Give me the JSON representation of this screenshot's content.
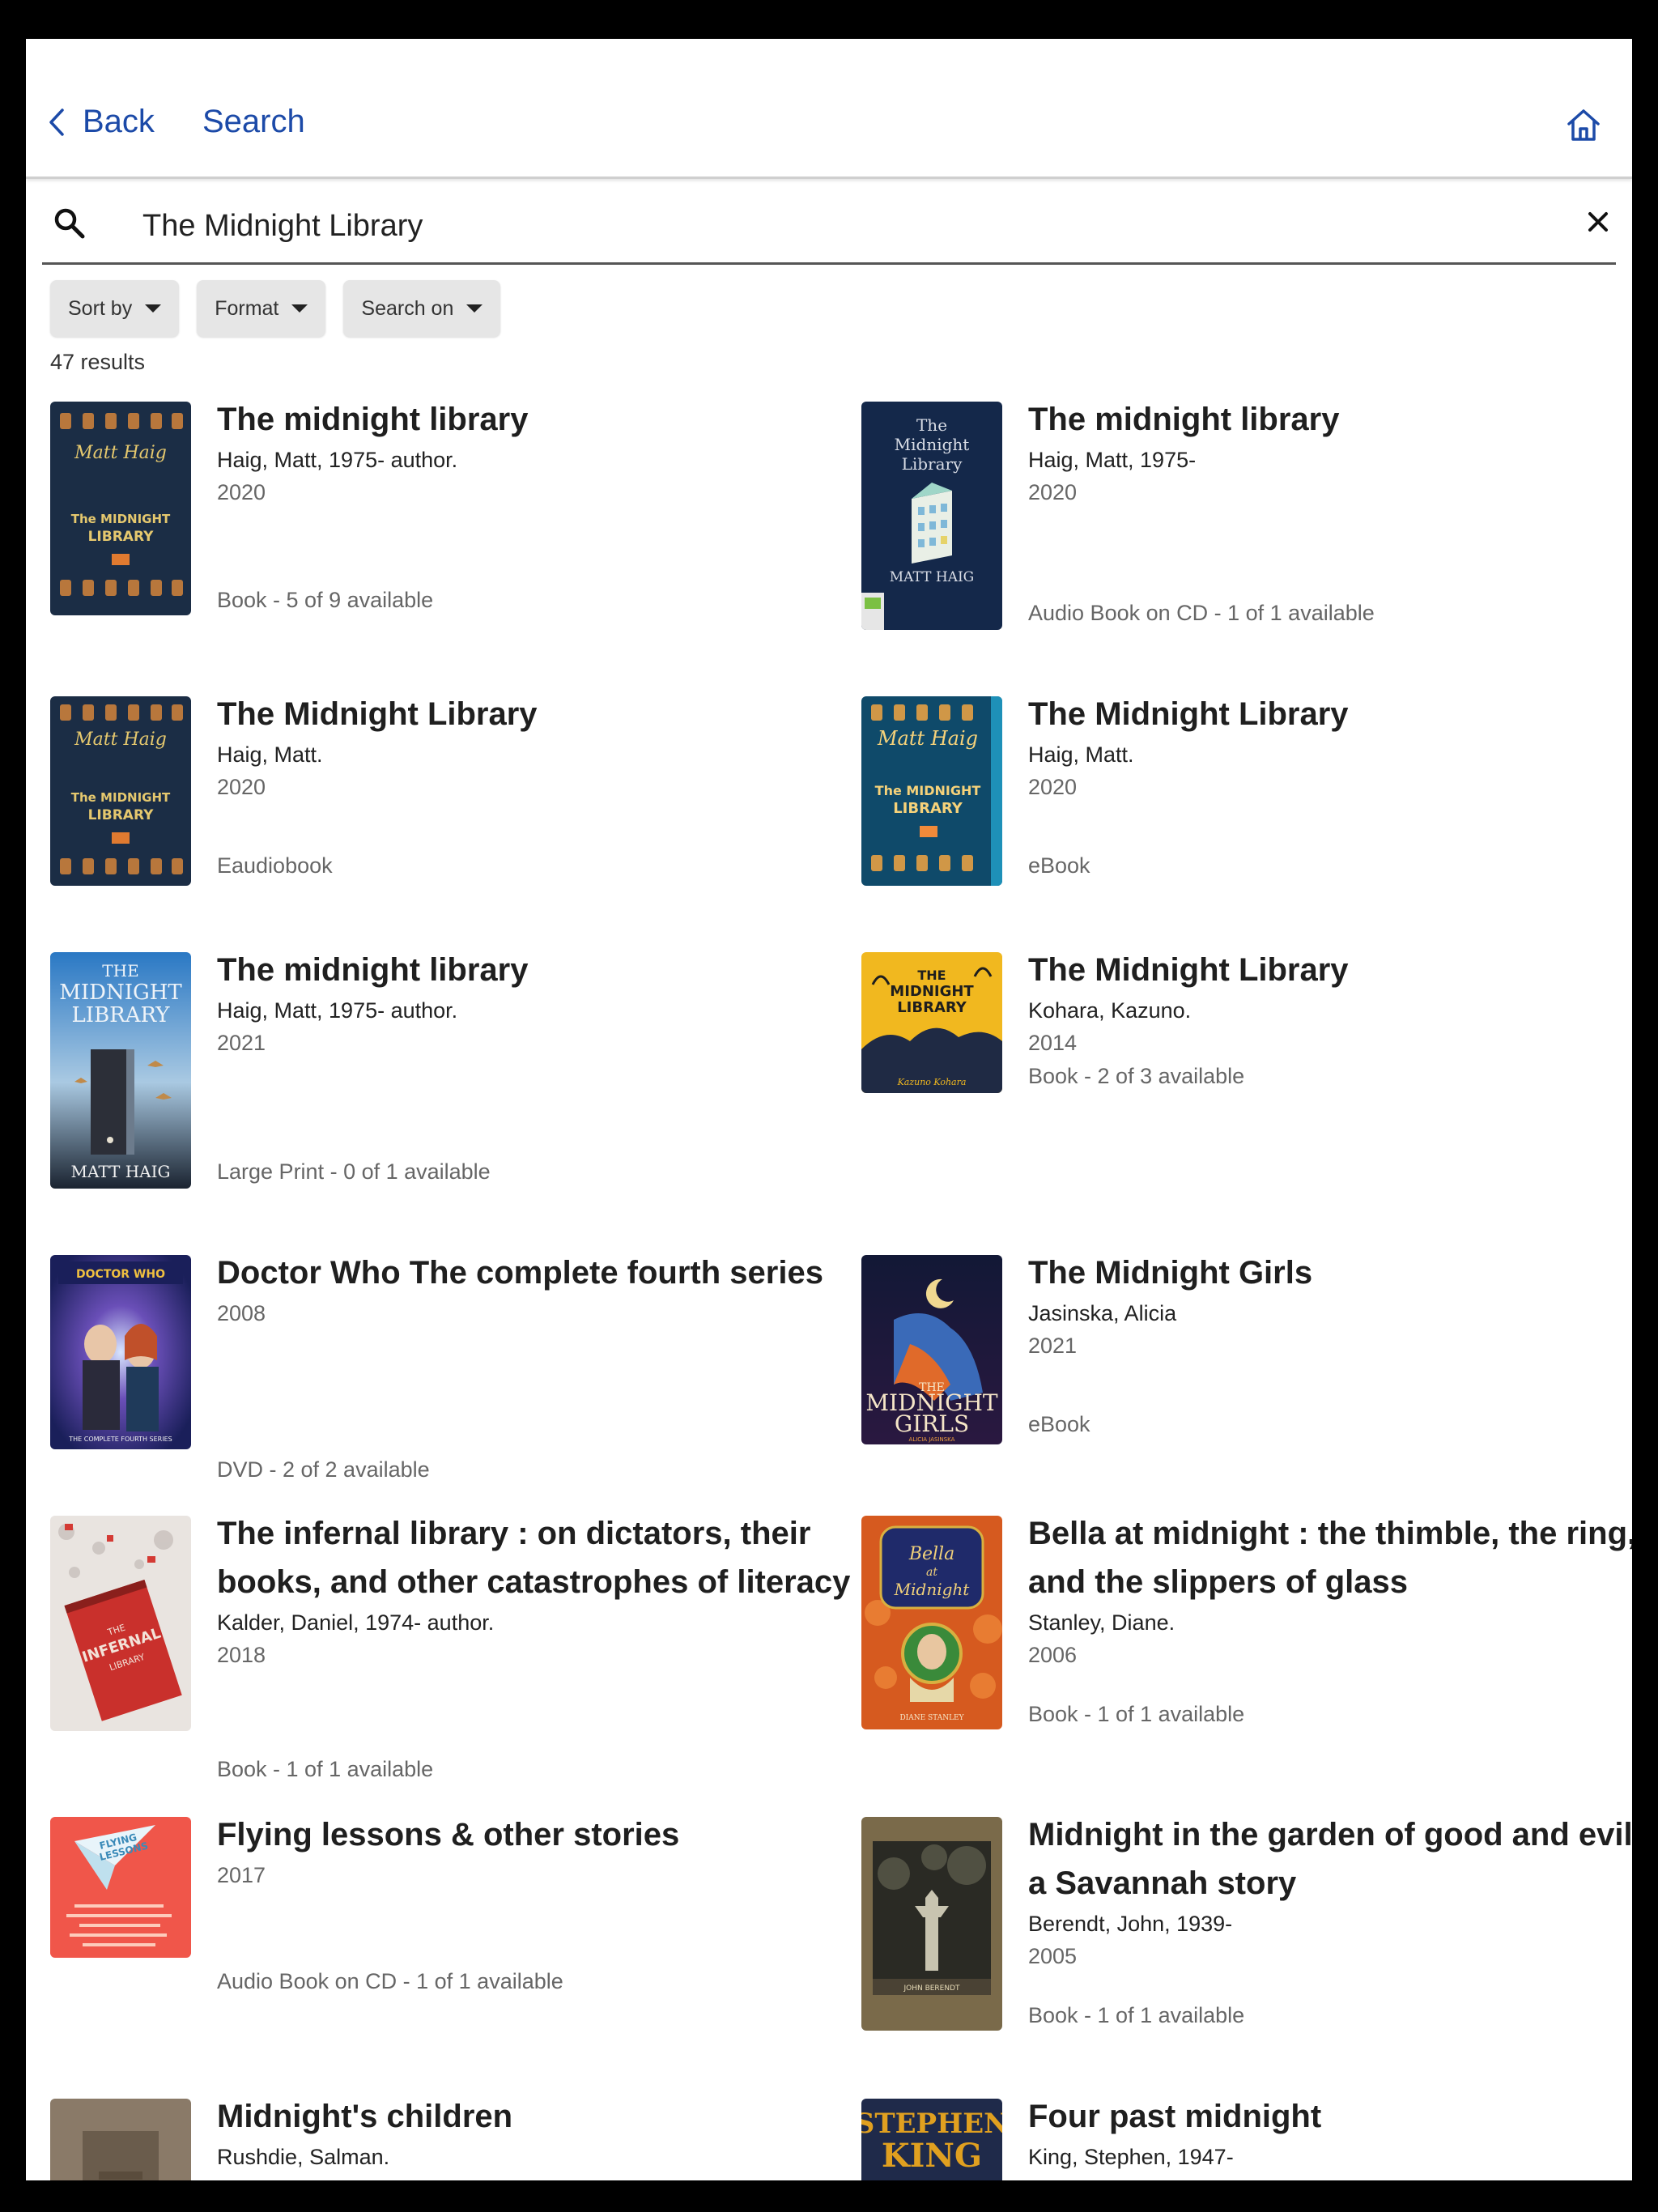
{
  "header": {
    "back_label": "Back",
    "search_label": "Search"
  },
  "search": {
    "query": "The Midnight Library",
    "placeholder": ""
  },
  "filters": {
    "sort_by": "Sort by",
    "format": "Format",
    "search_on": "Search on"
  },
  "results_count": "47 results",
  "results": [
    {
      "title": "The midnight library",
      "author": "Haig, Matt, 1975- author.",
      "year": "2020",
      "availability": "Book - 5 of 9 available"
    },
    {
      "title": "The midnight library",
      "author": "Haig, Matt, 1975-",
      "year": "2020",
      "availability": "Audio Book on CD - 1 of 1 available"
    },
    {
      "title": "The Midnight Library",
      "author": "Haig, Matt.",
      "year": "2020",
      "availability": "Eaudiobook"
    },
    {
      "title": "The Midnight Library",
      "author": "Haig, Matt.",
      "year": "2020",
      "availability": "eBook"
    },
    {
      "title": "The midnight library",
      "author": "Haig, Matt, 1975- author.",
      "year": "2021",
      "availability": "Large Print - 0 of 1 available"
    },
    {
      "title": "The Midnight Library",
      "author": "Kohara, Kazuno.",
      "year": "2014",
      "availability": "Book - 2 of 3 available"
    },
    {
      "title": "Doctor Who The complete fourth series",
      "author": "",
      "year": "2008",
      "availability": "DVD - 2 of 2 available"
    },
    {
      "title": "The Midnight Girls",
      "author": "Jasinska, Alicia",
      "year": "2021",
      "availability": "eBook"
    },
    {
      "title": "The infernal library : on dictators, their books, and other catastrophes of literacy",
      "author": "Kalder, Daniel, 1974- author.",
      "year": "2018",
      "availability": "Book - 1 of 1 available"
    },
    {
      "title": "Bella at midnight : the thimble, the ring, and the slippers of glass",
      "author": "Stanley, Diane.",
      "year": "2006",
      "availability": "Book - 1 of 1 available"
    },
    {
      "title": "Flying lessons & other stories",
      "author": "",
      "year": "2017",
      "availability": "Audio Book on CD - 1 of 1 available"
    },
    {
      "title": "Midnight in the garden of good and evil : a Savannah story",
      "author": "Berendt, John, 1939-",
      "year": "2005",
      "availability": "Book - 1 of 1 available"
    },
    {
      "title": "Midnight's children",
      "author": "Rushdie, Salman.",
      "year": "",
      "availability": ""
    },
    {
      "title": "Four past midnight",
      "author": "King, Stephen, 1947-",
      "year": "",
      "availability": ""
    }
  ],
  "covers": {
    "r0": {
      "text_lines": [
        "Matt Haig",
        "The MIDNIGHT",
        "LIBRARY"
      ]
    },
    "r1": {
      "text_lines": [
        "The",
        "Midnight",
        "Library",
        "MATT HAIG"
      ]
    },
    "r2": {
      "text_lines": [
        "Matt Haig",
        "The MIDNIGHT",
        "LIBRARY"
      ]
    },
    "r3": {
      "text_lines": [
        "Matt Haig",
        "The MIDNIGHT",
        "LIBRARY"
      ]
    },
    "r4": {
      "text_lines": [
        "THE",
        "MIDNIGHT",
        "LIBRARY",
        "MATT HAIG"
      ]
    },
    "r5": {
      "text_lines": [
        "THE",
        "MIDNIGHT",
        "LIBRARY",
        "Kazuno Kohara"
      ]
    },
    "r6": {
      "text_lines": [
        "DOCTOR WHO",
        "THE COMPLETE FOURTH SERIES"
      ]
    },
    "r7": {
      "text_lines": [
        "THE",
        "MIDNIGHT",
        "GIRLS",
        "ALICIA JASINSKA"
      ]
    },
    "r8": {
      "text_lines": [
        "THE",
        "INFERNAL",
        "LIBRARY"
      ]
    },
    "r9": {
      "text_lines": [
        "Bella",
        "at",
        "Midnight",
        "DIANE STANLEY"
      ]
    },
    "r10": {
      "text_lines": [
        "FLYING",
        "LESSONS"
      ]
    },
    "r11": {
      "text_lines": [
        "JOHN BERENDT"
      ]
    },
    "r13": {
      "text_lines": [
        "STEPHEN",
        "KING"
      ]
    }
  }
}
